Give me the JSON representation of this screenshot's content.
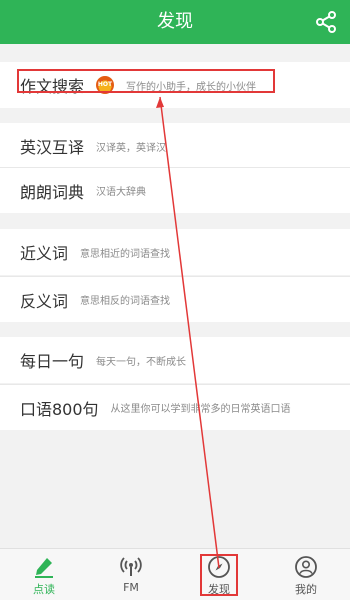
{
  "header": {
    "title": "发现",
    "share_icon": "share-icon"
  },
  "list": [
    {
      "title": "作文搜索",
      "badge": "HOT",
      "desc": "写作的小助手，成长的小伙伴"
    },
    {
      "title": "英汉互译",
      "desc": "汉译英，英译汉"
    },
    {
      "title": "朗朗词典",
      "desc": "汉语大辞典"
    },
    {
      "title": "近义词",
      "desc": "意思相近的词语查找"
    },
    {
      "title": "反义词",
      "desc": "意思相反的词语查找"
    },
    {
      "title": "每日一句",
      "desc": "每天一句，不断成长"
    },
    {
      "title": "口语800句",
      "desc": "从这里你可以学到非常多的日常英语口语"
    }
  ],
  "tabs": [
    {
      "label": "点读",
      "icon": "pen-icon",
      "active": true
    },
    {
      "label": "FM",
      "icon": "radio-icon"
    },
    {
      "label": "发现",
      "icon": "compass-icon"
    },
    {
      "label": "我的",
      "icon": "user-icon"
    }
  ],
  "colors": {
    "brand": "#2fb457",
    "highlight": "#e23838"
  }
}
